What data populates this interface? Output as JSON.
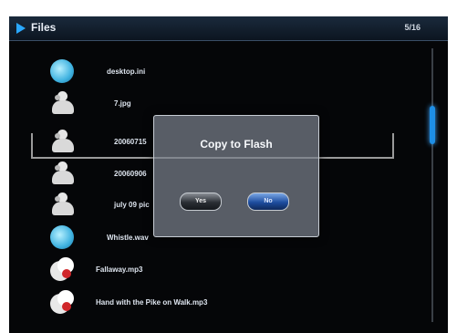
{
  "header": {
    "title": "Files",
    "counter": "5/16",
    "play_icon": "play-icon"
  },
  "list": {
    "items": [
      {
        "icon": "folder-icon",
        "label": "desktop.ini"
      },
      {
        "icon": "user-icon",
        "label": "7.jpg"
      },
      {
        "icon": "user-icon",
        "label": "20060715"
      },
      {
        "icon": "user-icon",
        "label": "20060906"
      },
      {
        "icon": "user-icon",
        "label": "july 09 pic"
      },
      {
        "icon": "folder-icon",
        "label": "Whistle.wav"
      },
      {
        "icon": "music-file-icon",
        "label": "Fallaway.mp3"
      },
      {
        "icon": "music-file-icon",
        "label": "Hand with the Pike on Walk.mp3"
      }
    ]
  },
  "dialog": {
    "title": "Copy to Flash",
    "yes_label": "Yes",
    "no_label": "No"
  },
  "colors": {
    "accent": "#2aa8ff",
    "background": "#050608"
  }
}
